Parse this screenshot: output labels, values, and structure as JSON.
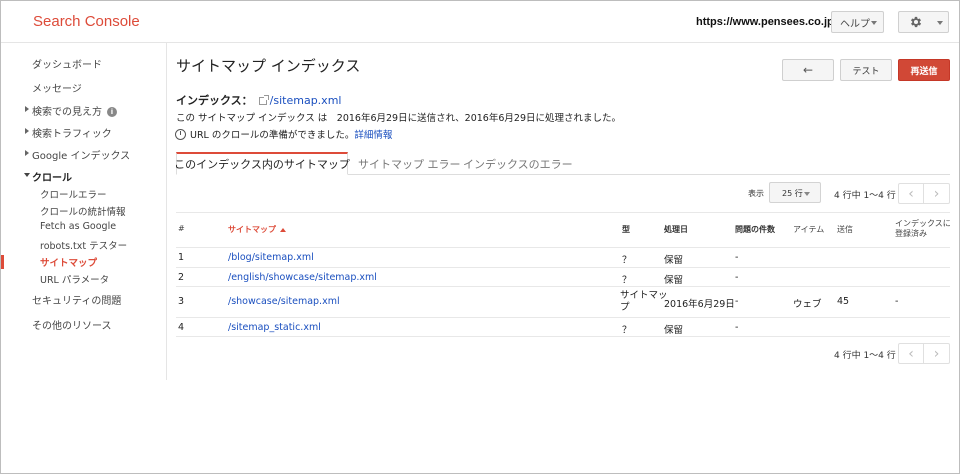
{
  "app": {
    "logo": "Search Console",
    "site_url": "https://www.pensees.co.jp/",
    "help_label": "ヘルプ"
  },
  "sidebar": {
    "dashboard": "ダッシュボード",
    "messages": "メッセージ",
    "search_appearance": "検索での見え方",
    "search_traffic": "検索トラフィック",
    "google_index": "Google インデックス",
    "crawl": "クロール",
    "crawl_items": [
      "クロールエラー",
      "クロールの統計情報",
      "Fetch as Google",
      "robots.txt テスター",
      "サイトマップ",
      "URL パラメータ"
    ],
    "security": "セキュリティの問題",
    "other_resources": "その他のリソース"
  },
  "page": {
    "title": "サイトマップ インデックス",
    "test_label": "テスト",
    "resend_label": "再送信",
    "index_label": "インデックス：",
    "index_file": "/sitemap.xml",
    "description": "この サイトマップ インデックス は　2016年6月29日に送信され、2016年6月29日に処理されました。",
    "crawl_notice": "URL のクロールの準備ができました。",
    "details_link": "詳細情報"
  },
  "tabs": [
    "このインデックス内のサイトマップ",
    "サイトマップ エラー",
    "インデックスのエラー"
  ],
  "pager": {
    "show_label": "表示",
    "per_page": "25 行",
    "range_text": "4 行中 1〜4 行"
  },
  "table": {
    "headers": {
      "num": "#",
      "sitemap": "サイトマップ",
      "type": "型",
      "processed": "処理日",
      "issues": "問題の件数",
      "items": "アイテム",
      "submitted": "送信",
      "indexed_l1": "インデックスに",
      "indexed_l2": "登録済み"
    },
    "rows": [
      {
        "num": "1",
        "sitemap": "/blog/sitemap.xml",
        "type": "？",
        "processed": "保留",
        "issues": "-",
        "items": "",
        "submitted": "",
        "indexed": ""
      },
      {
        "num": "2",
        "sitemap": "/english/showcase/sitemap.xml",
        "type": "？",
        "processed": "保留",
        "issues": "-",
        "items": "",
        "submitted": "",
        "indexed": ""
      },
      {
        "num": "3",
        "sitemap": "/showcase/sitemap.xml",
        "type_l1": "サイトマッ",
        "type_l2": "プ",
        "processed": "2016年6月29日",
        "issues": "-",
        "items": "ウェブ",
        "submitted": "45",
        "indexed": "-"
      },
      {
        "num": "4",
        "sitemap": "/sitemap_static.xml",
        "type": "？",
        "processed": "保留",
        "issues": "-",
        "items": "",
        "submitted": "",
        "indexed": ""
      }
    ]
  }
}
